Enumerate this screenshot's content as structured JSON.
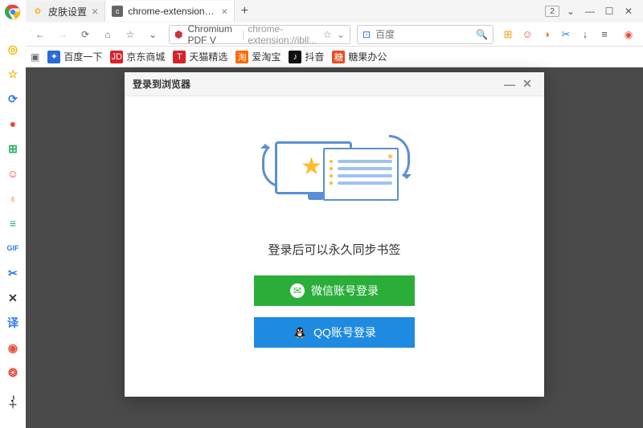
{
  "tabs": [
    {
      "label": "皮肤设置",
      "favicon": "✿"
    },
    {
      "label": "chrome-extension://ibllepbpa",
      "favicon": "C"
    }
  ],
  "tabcount_badge": "2",
  "address": {
    "prefix": "Chromium PDF V",
    "url": "chrome-extension://ibll..."
  },
  "search": {
    "placeholder": "百度"
  },
  "bookmarks": [
    {
      "label": "百度一下",
      "color": "#2b6bd8",
      "glyph": "✦"
    },
    {
      "label": "京东商城",
      "color": "#d8232a",
      "glyph": "JD"
    },
    {
      "label": "天猫精选",
      "color": "#d8232a",
      "glyph": "T"
    },
    {
      "label": "爱淘宝",
      "color": "#ff6a00",
      "glyph": "淘"
    },
    {
      "label": "抖音",
      "color": "#111",
      "glyph": "♪"
    },
    {
      "label": "糖果办公",
      "color": "#e94f1d",
      "glyph": "糖"
    }
  ],
  "dialog": {
    "title": "登录到浏览器",
    "message": "登录后可以永久同步书签",
    "wechat_btn": "微信账号登录",
    "qq_btn": "QQ账号登录"
  },
  "sidebar_icons": [
    {
      "glyph": "◎",
      "color": "#f7b500"
    },
    {
      "glyph": "☆",
      "color": "#f7b500"
    },
    {
      "glyph": "⟳",
      "color": "#2b7de9"
    },
    {
      "glyph": "●",
      "color": "#e74c3c"
    },
    {
      "glyph": "⊞",
      "color": "#27ae60"
    },
    {
      "glyph": "☺",
      "color": "#e74c3c"
    },
    {
      "glyph": "♁",
      "color": "#e67e22"
    },
    {
      "glyph": "≡",
      "color": "#27ae60"
    },
    {
      "glyph": "GIF",
      "color": "#2b7de9"
    },
    {
      "glyph": "✂",
      "color": "#2b7de9"
    },
    {
      "glyph": "✕",
      "color": "#333"
    },
    {
      "glyph": "译",
      "color": "#2b7de9"
    },
    {
      "glyph": "◉",
      "color": "#e74c3c"
    },
    {
      "glyph": "❂",
      "color": "#e74c3c"
    },
    {
      "glyph": "♪",
      "color": "#111"
    }
  ],
  "right_ext": [
    {
      "glyph": "⊞",
      "color": "#f39c12"
    },
    {
      "glyph": "☺",
      "color": "#e74c3c"
    },
    {
      "glyph": "◑",
      "color": "#e67e22"
    },
    {
      "glyph": "✂",
      "color": "#2b7de9"
    },
    {
      "glyph": "↓",
      "color": "#555"
    },
    {
      "glyph": "≡",
      "color": "#555"
    }
  ]
}
